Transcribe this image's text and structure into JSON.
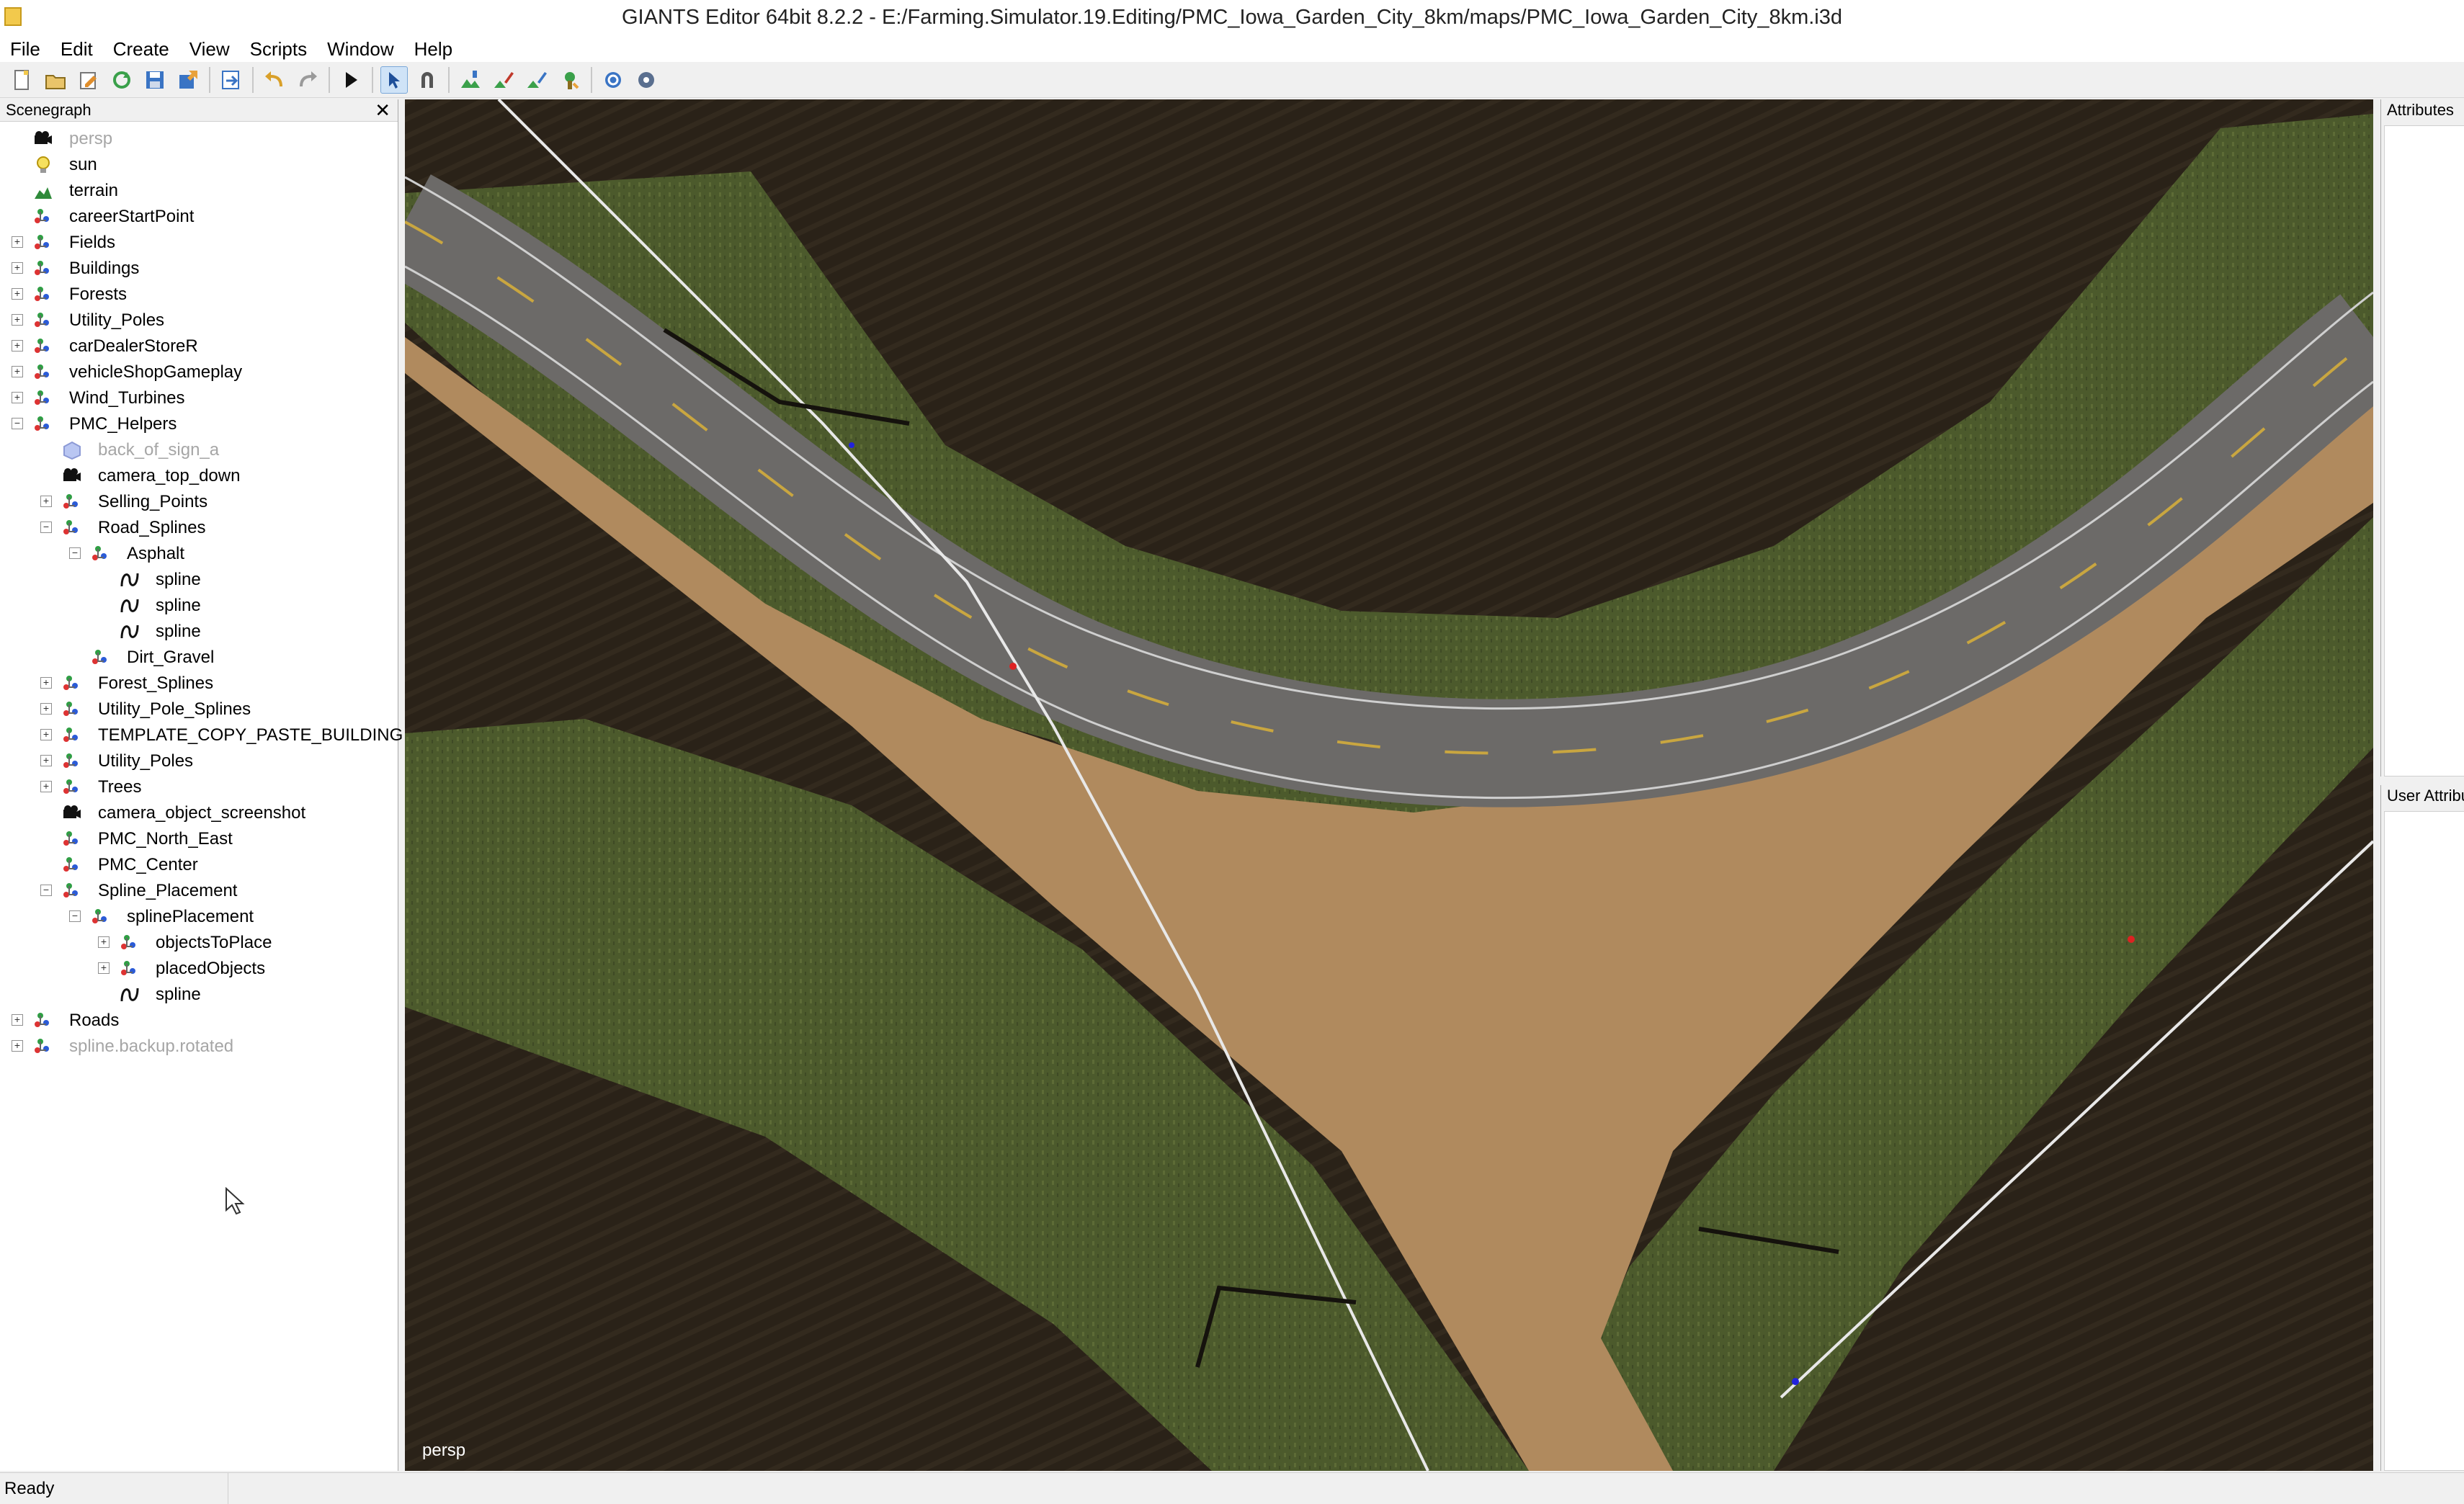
{
  "window": {
    "title": "GIANTS Editor 64bit 8.2.2 - E:/Farming.Simulator.19.Editing/PMC_Iowa_Garden_City_8km/maps/PMC_Iowa_Garden_City_8km.i3d"
  },
  "menu": [
    "File",
    "Edit",
    "Create",
    "View",
    "Scripts",
    "Window",
    "Help"
  ],
  "toolbar": {
    "icons": [
      "new-file-icon",
      "open-file-icon",
      "edit-file-icon",
      "reload-icon",
      "save-icon",
      "export-icon",
      "import-icon",
      "undo-icon",
      "redo-icon",
      "play-icon",
      "select-mode-icon",
      "magnet-icon",
      "terrain-sculpt-icon",
      "terrain-paint-icon",
      "foliage-paint-icon",
      "placement-icon",
      "refresh-icon",
      "settings-icon"
    ]
  },
  "scenegraph": {
    "title": "Scenegraph",
    "close": "✕",
    "nodes": [
      {
        "label": "persp",
        "depth": 0,
        "icon": "camera",
        "expander": "",
        "disabled": true
      },
      {
        "label": "sun",
        "depth": 0,
        "icon": "light",
        "expander": "",
        "disabled": false
      },
      {
        "label": "terrain",
        "depth": 0,
        "icon": "terrain",
        "expander": "",
        "disabled": false
      },
      {
        "label": "careerStartPoint",
        "depth": 0,
        "icon": "transform",
        "expander": "",
        "disabled": false
      },
      {
        "label": "Fields",
        "depth": 0,
        "icon": "transform",
        "expander": "+",
        "disabled": false
      },
      {
        "label": "Buildings",
        "depth": 0,
        "icon": "transform",
        "expander": "+",
        "disabled": false
      },
      {
        "label": "Forests",
        "depth": 0,
        "icon": "transform",
        "expander": "+",
        "disabled": false
      },
      {
        "label": "Utility_Poles",
        "depth": 0,
        "icon": "transform",
        "expander": "+",
        "disabled": false
      },
      {
        "label": "carDealerStoreR",
        "depth": 0,
        "icon": "transform",
        "expander": "+",
        "disabled": false
      },
      {
        "label": "vehicleShopGameplay",
        "depth": 0,
        "icon": "transform",
        "expander": "+",
        "disabled": false
      },
      {
        "label": "Wind_Turbines",
        "depth": 0,
        "icon": "transform",
        "expander": "+",
        "disabled": false
      },
      {
        "label": "PMC_Helpers",
        "depth": 0,
        "icon": "transform",
        "expander": "−",
        "disabled": false
      },
      {
        "label": "back_of_sign_a",
        "depth": 1,
        "icon": "shape",
        "expander": "",
        "disabled": true
      },
      {
        "label": "camera_top_down",
        "depth": 1,
        "icon": "camera",
        "expander": "",
        "disabled": false
      },
      {
        "label": "Selling_Points",
        "depth": 1,
        "icon": "transform",
        "expander": "+",
        "disabled": false
      },
      {
        "label": "Road_Splines",
        "depth": 1,
        "icon": "transform",
        "expander": "−",
        "disabled": false
      },
      {
        "label": "Asphalt",
        "depth": 2,
        "icon": "transform",
        "expander": "−",
        "disabled": false
      },
      {
        "label": "spline",
        "depth": 3,
        "icon": "spline",
        "expander": "",
        "disabled": false
      },
      {
        "label": "spline",
        "depth": 3,
        "icon": "spline",
        "expander": "",
        "disabled": false
      },
      {
        "label": "spline",
        "depth": 3,
        "icon": "spline",
        "expander": "",
        "disabled": false
      },
      {
        "label": "Dirt_Gravel",
        "depth": 2,
        "icon": "transform",
        "expander": "",
        "disabled": false
      },
      {
        "label": "Forest_Splines",
        "depth": 1,
        "icon": "transform",
        "expander": "+",
        "disabled": false
      },
      {
        "label": "Utility_Pole_Splines",
        "depth": 1,
        "icon": "transform",
        "expander": "+",
        "disabled": false
      },
      {
        "label": "TEMPLATE_COPY_PASTE_BUILDING",
        "depth": 1,
        "icon": "transform",
        "expander": "+",
        "disabled": false
      },
      {
        "label": "Utility_Poles",
        "depth": 1,
        "icon": "transform",
        "expander": "+",
        "disabled": false
      },
      {
        "label": "Trees",
        "depth": 1,
        "icon": "transform",
        "expander": "+",
        "disabled": false
      },
      {
        "label": "camera_object_screenshot",
        "depth": 1,
        "icon": "camera",
        "expander": "",
        "disabled": false
      },
      {
        "label": "PMC_North_East",
        "depth": 1,
        "icon": "transform",
        "expander": "",
        "disabled": false
      },
      {
        "label": "PMC_Center",
        "depth": 1,
        "icon": "transform",
        "expander": "",
        "disabled": false
      },
      {
        "label": "Spline_Placement",
        "depth": 1,
        "icon": "transform",
        "expander": "−",
        "disabled": false
      },
      {
        "label": "splinePlacement",
        "depth": 2,
        "icon": "transform",
        "expander": "−",
        "disabled": false
      },
      {
        "label": "objectsToPlace",
        "depth": 3,
        "icon": "transform",
        "expander": "+",
        "disabled": false
      },
      {
        "label": "placedObjects",
        "depth": 3,
        "icon": "transform",
        "expander": "+",
        "disabled": false
      },
      {
        "label": "spline",
        "depth": 3,
        "icon": "spline",
        "expander": "",
        "disabled": false
      },
      {
        "label": "Roads",
        "depth": 0,
        "icon": "transform",
        "expander": "+",
        "disabled": false
      },
      {
        "label": "spline.backup.rotated",
        "depth": 0,
        "icon": "transform",
        "expander": "+",
        "disabled": true
      }
    ]
  },
  "viewport": {
    "camera_label": "persp"
  },
  "attributes": {
    "title": "Attributes"
  },
  "user_attributes": {
    "title": "User Attributes"
  },
  "status": {
    "text": "Ready"
  },
  "colors": {
    "field_dark": "#2a2218",
    "grass": "#4c5a2c",
    "dirt": "#b08a5e",
    "asphalt": "#6c6a68",
    "center_line": "#c9a640",
    "spline_line": "#e8e8e8"
  }
}
